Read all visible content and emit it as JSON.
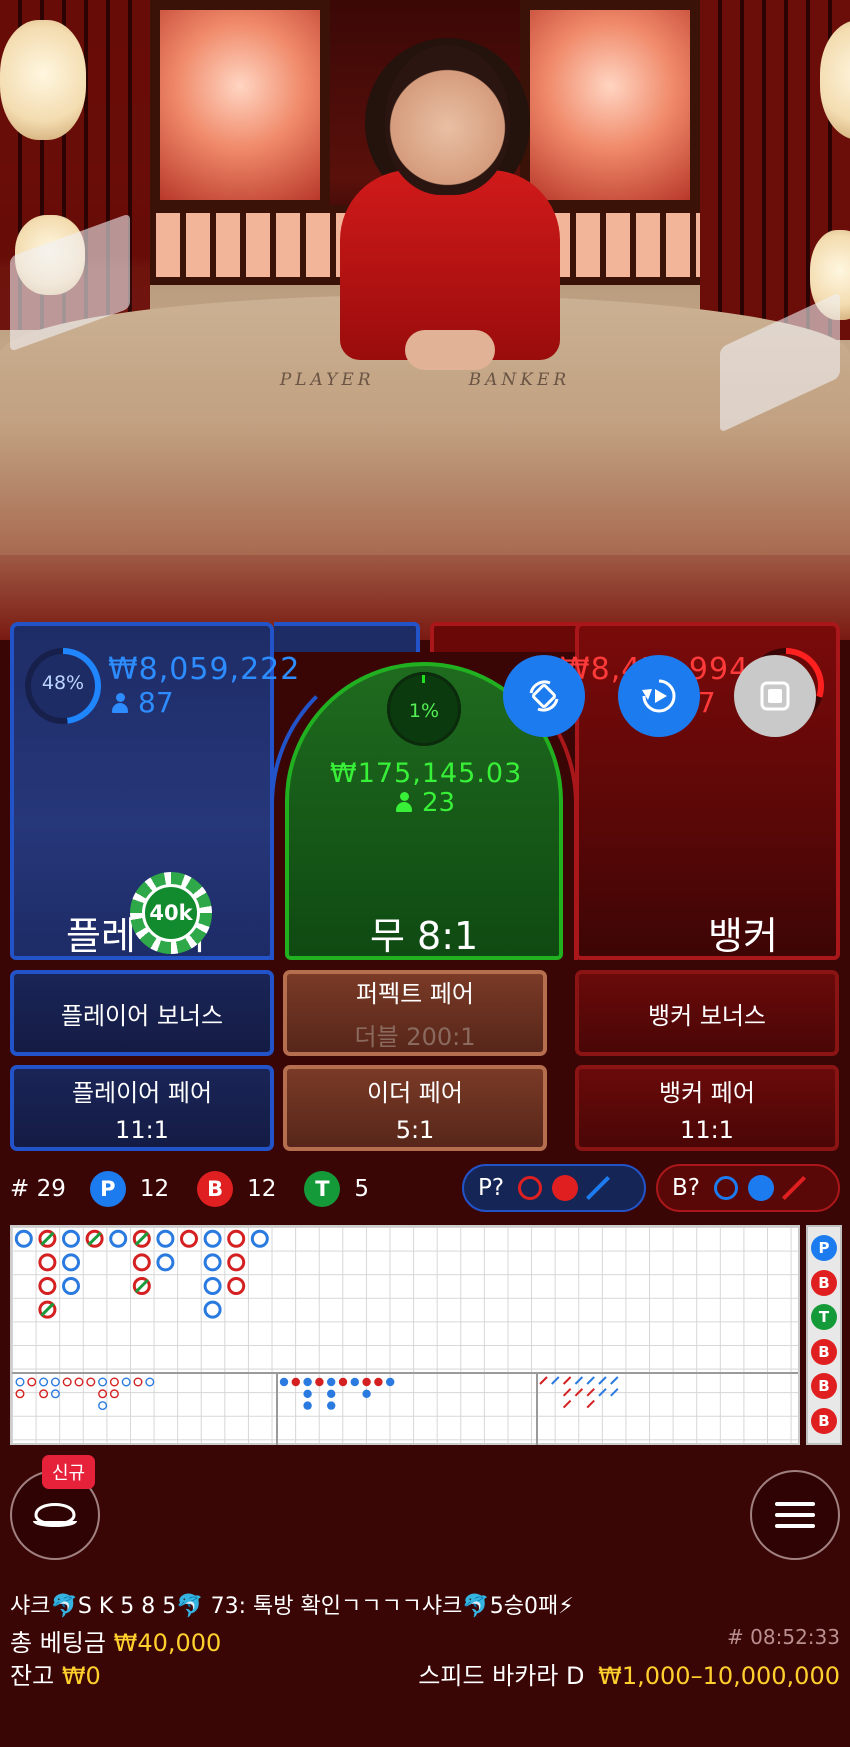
{
  "players": {
    "pct": "48%",
    "amount": "₩8,059,222",
    "count": "87",
    "label": "플레이어",
    "chip": "40k"
  },
  "tie": {
    "pct": "1%",
    "amount": "₩175,145.03",
    "count": "23",
    "label": "무 8:1"
  },
  "banker": {
    "amount": "₩8,47?,994",
    "count": "57",
    "label": "뱅커"
  },
  "side_bets": {
    "player_bonus": "플레이어 보너스",
    "perfect_pair": "퍼펙트 페어",
    "perfect_pair_sub": "더블 200:1",
    "banker_bonus": "뱅커 보너스",
    "player_pair": "플레이어 페어",
    "player_pair_odds": "11:1",
    "either_pair": "이더 페어",
    "either_pair_odds": "5:1",
    "banker_pair": "뱅커 페어",
    "banker_pair_odds": "11:1"
  },
  "stats": {
    "round": "# 29",
    "p_letter": "P",
    "p_count": "12",
    "b_letter": "B",
    "b_count": "12",
    "t_letter": "T",
    "t_count": "5",
    "player_ask": "P?",
    "banker_ask": "B?"
  },
  "prediction": [
    "P",
    "B",
    "T",
    "B",
    "B",
    "B"
  ],
  "new_label": "신규",
  "chat": "샤크🐬S K 5 8 5🐬 73: 톡방 확인ㄱㄱㄱㄱ샤크🐬5승0패⚡",
  "footer": {
    "total_bet_label": "총 베팅금",
    "total_bet_value": "₩40,000",
    "balance_label": "잔고",
    "balance_value": "₩0",
    "round_id": "# 08:52:33",
    "table_name": "스피드 바카라 D",
    "limits": "₩1,000–10,000,000"
  },
  "colors": {
    "player": "#2353c8",
    "banker": "#a9171a",
    "tie": "#20b020",
    "accent_gold": "#ffcf2e"
  },
  "icons": [
    "rotate-icon",
    "replay-icon",
    "stop-icon",
    "lobby-icon",
    "menu-icon"
  ]
}
